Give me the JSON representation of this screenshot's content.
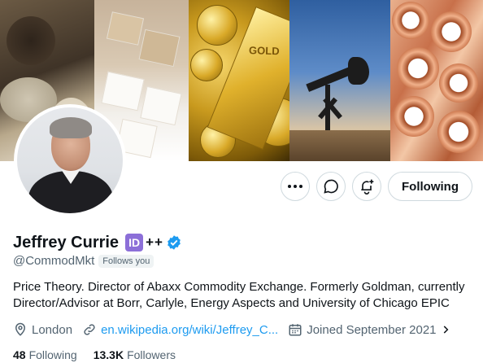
{
  "profile": {
    "display_name": "Jeffrey Currie",
    "id_badge": "ID",
    "name_suffix": "++",
    "handle": "@CommodMkt",
    "follows_you": "Follows you",
    "bio": "Price Theory. Director of Abaxx Commodity Exchange. Formerly Goldman, currently Director/Advisor at Borr, Carlyle, Energy Aspects and University of Chicago EPIC",
    "location": "London",
    "website": "en.wikipedia.org/wiki/Jeffrey_C...",
    "joined": "Joined September 2021"
  },
  "actions": {
    "following_label": "Following"
  },
  "stats": {
    "following_count": "48",
    "following_label": "Following",
    "followers_count": "13.3K",
    "followers_label": "Followers"
  },
  "banner": {
    "gold_text": "GOLD"
  },
  "icons": {
    "more": "more-icon",
    "dm": "message-icon",
    "notify": "bell-plus-icon",
    "verified": "verified-badge-icon",
    "location": "location-pin-icon",
    "link": "link-icon",
    "calendar": "calendar-icon",
    "chevron": "chevron-right-icon"
  },
  "colors": {
    "accent": "#1d9bf0",
    "id_badge": "#8c6fd8",
    "text_primary": "#0f1419",
    "text_secondary": "#536471"
  }
}
